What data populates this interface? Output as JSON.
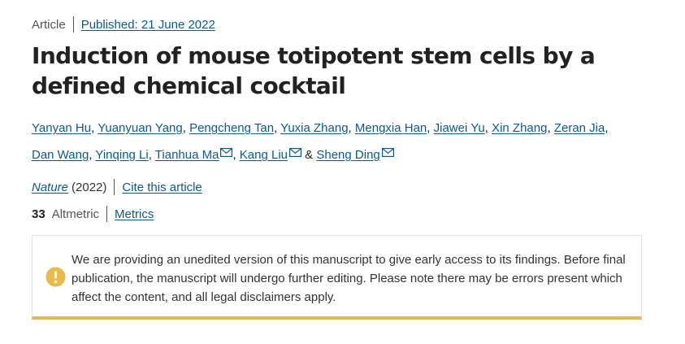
{
  "article": {
    "type": "Article",
    "published": "Published: 21 June 2022",
    "title": "Induction of mouse totipotent stem cells by a defined chemical cocktail"
  },
  "authors": [
    "Yanyan Hu",
    "Yuanyuan Yang",
    "Pengcheng Tan",
    "Yuxia Zhang",
    "Mengxia Han",
    "Jiawei Yu",
    "Xin Zhang",
    "Zeran Jia",
    "Dan Wang",
    "Yinqing Li",
    "Tianhua Ma",
    "Kang Liu",
    "Sheng Ding"
  ],
  "journal": {
    "name": "Nature",
    "year": "(2022)",
    "cite_label": "Cite this article"
  },
  "metrics": {
    "altmetric_count": "33",
    "altmetric_label": "Altmetric",
    "metrics_label": "Metrics"
  },
  "notice": {
    "icon": "exclamation-circle-icon",
    "color": "#e9b949",
    "text": "We are providing an unedited version of this manuscript to give early access to its findings. Before final publication, the manuscript will undergo further editing. Please note there may be errors present which affect the content, and all legal disclaimers apply."
  },
  "colors": {
    "link": "#0c5a8c",
    "accent_bar": "#e2b74c"
  }
}
